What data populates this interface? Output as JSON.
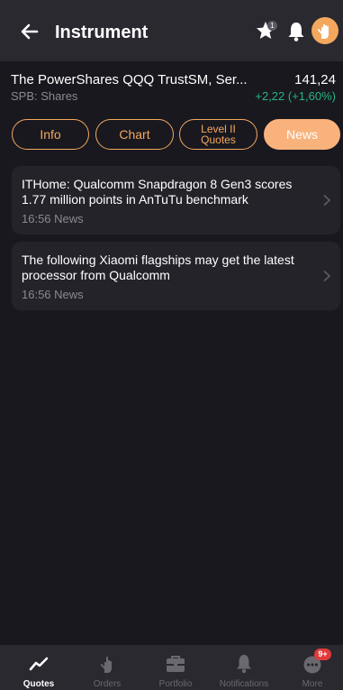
{
  "header": {
    "title": "Instrument",
    "favorites_badge": "1",
    "icons": [
      "back-arrow-icon",
      "star-icon",
      "bell-icon",
      "avatar"
    ]
  },
  "instrument": {
    "name": "The PowerShares QQQ TrustSM, Ser...",
    "market": "SPB: Shares",
    "price": "141,24",
    "change": "+2,22 (+1,60%)"
  },
  "tabs": [
    {
      "label": "Info"
    },
    {
      "label": "Chart"
    },
    {
      "label": "Level II Quotes"
    },
    {
      "label": "News"
    }
  ],
  "news": [
    {
      "headline": "ITHome: Qualcomm Snapdragon 8 Gen3 scores 1.77 million points in AnTuTu benchmark",
      "meta": "16:56 News"
    },
    {
      "headline": "The following Xiaomi flagships may get the latest processor from Qualcomm",
      "meta": "16:56 News"
    }
  ],
  "bottom_nav": {
    "items": [
      {
        "label": "Quotes",
        "icon": "chart-line-icon"
      },
      {
        "label": "Orders",
        "icon": "hand-icon"
      },
      {
        "label": "Portfolio",
        "icon": "briefcase-icon"
      },
      {
        "label": "Notifications",
        "icon": "bell-icon"
      },
      {
        "label": "More",
        "icon": "more-dots-icon"
      }
    ],
    "more_badge": "9+"
  },
  "colors": {
    "background": "#19181f",
    "header": "#2a2930",
    "accent": "#f3a85e",
    "positive": "#29b37f",
    "badge": "#e23a3a"
  }
}
